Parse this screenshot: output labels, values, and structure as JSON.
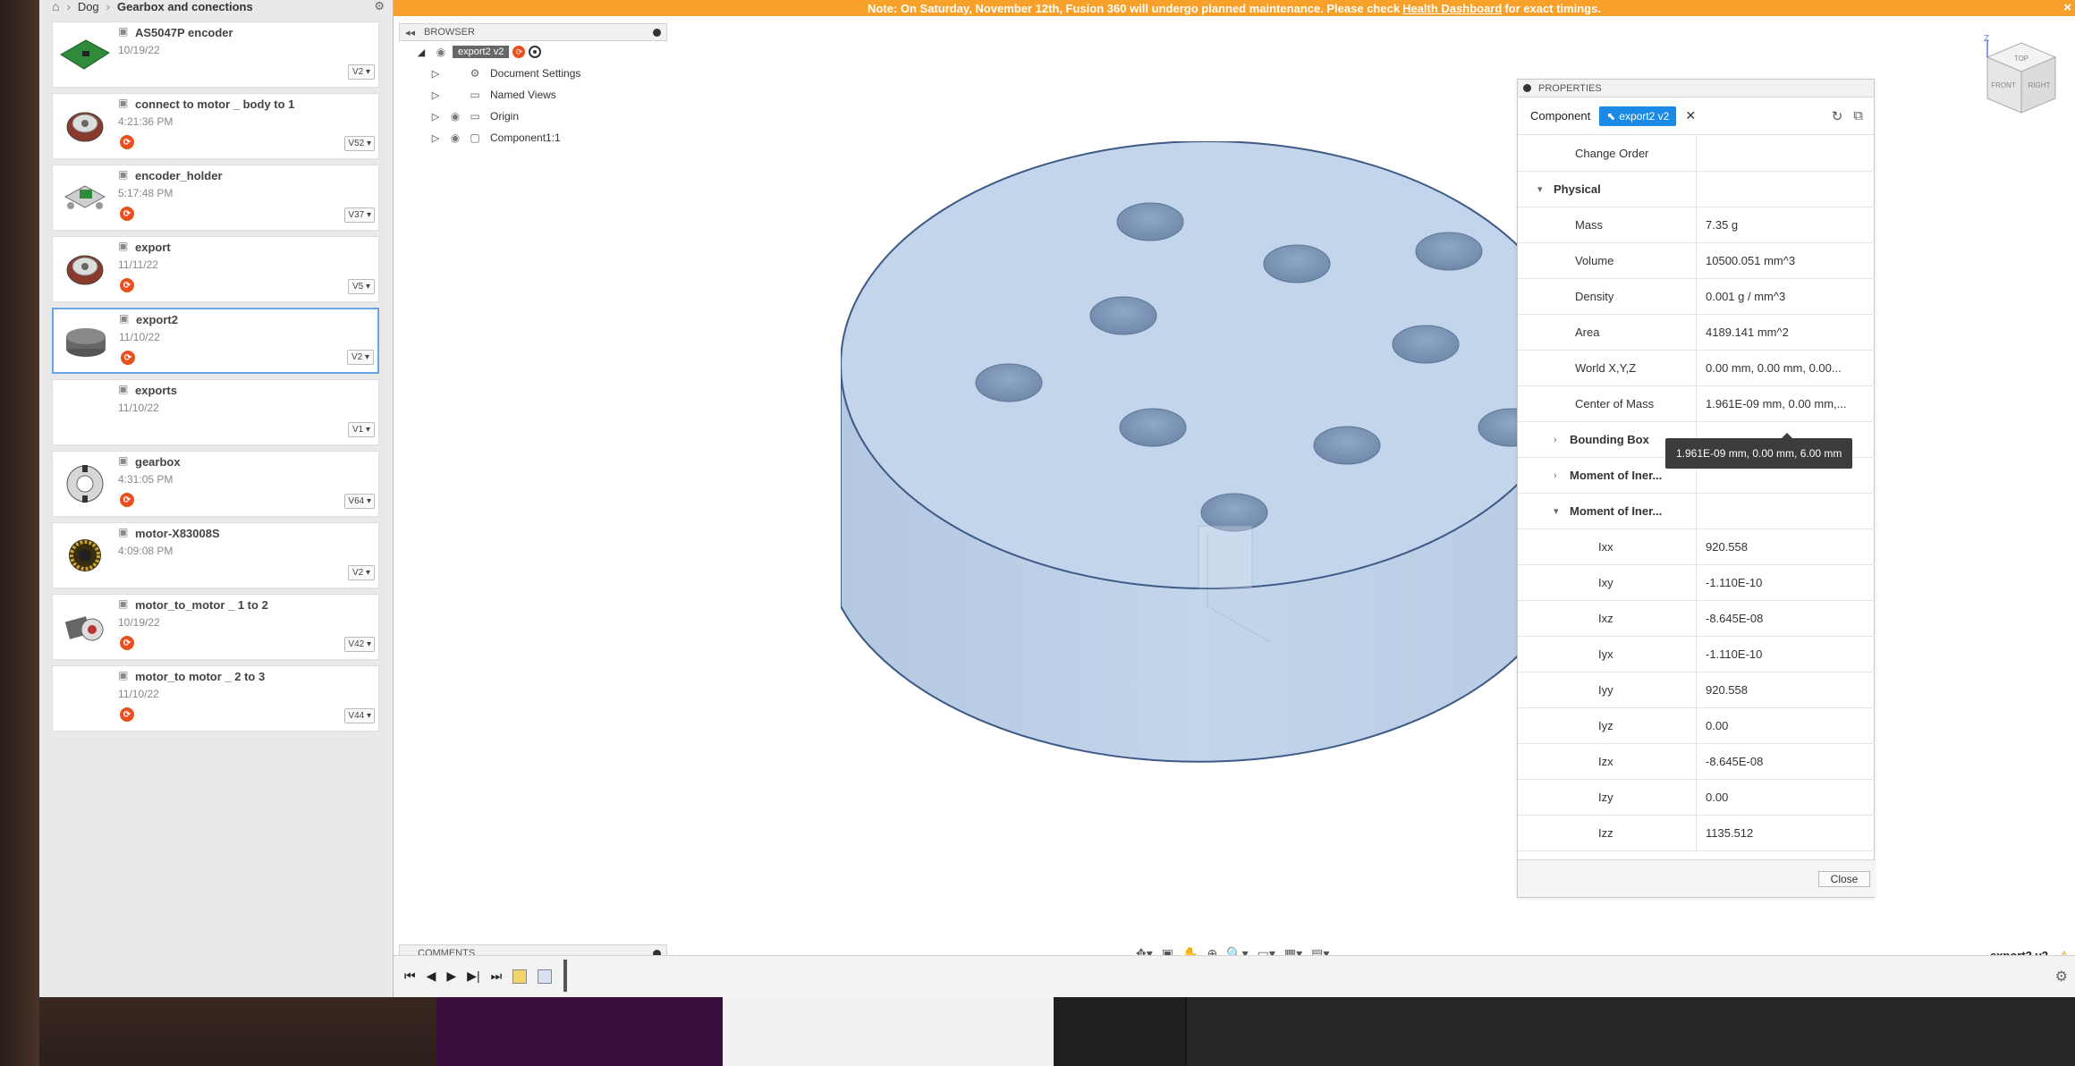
{
  "notice": {
    "prefix": "Note: On Saturday, November 12th, Fusion 360 will undergo planned maintenance. Please check",
    "link": "Health Dashboard",
    "suffix": "for exact timings.",
    "close": "×"
  },
  "data_panel": {
    "breadcrumb": {
      "project": "Dog",
      "folder": "Gearbox and conections"
    },
    "files": [
      {
        "name": "AS5047P encoder",
        "date": "10/19/22",
        "version": "V2 ▾",
        "badge": false,
        "thumb": "pcb"
      },
      {
        "name": "connect to motor _ body to 1",
        "date": "4:21:36 PM",
        "version": "V52 ▾",
        "badge": true,
        "thumb": "motor"
      },
      {
        "name": "encoder_holder",
        "date": "5:17:48 PM",
        "version": "V37 ▾",
        "badge": true,
        "thumb": "holder"
      },
      {
        "name": "export",
        "date": "11/11/22",
        "version": "V5 ▾",
        "badge": true,
        "thumb": "motor"
      },
      {
        "name": "export2",
        "date": "11/10/22",
        "version": "V2 ▾",
        "badge": true,
        "thumb": "disk",
        "selected": true
      },
      {
        "name": "exports",
        "date": "11/10/22",
        "version": "V1 ▾",
        "badge": false,
        "thumb": "none"
      },
      {
        "name": "gearbox",
        "date": "4:31:05 PM",
        "version": "V64 ▾",
        "badge": true,
        "thumb": "gearbox"
      },
      {
        "name": "motor-X83008S",
        "date": "4:09:08 PM",
        "version": "V2 ▾",
        "badge": false,
        "thumb": "coil"
      },
      {
        "name": "motor_to_motor _ 1 to 2",
        "date": "10/19/22",
        "version": "V42 ▾",
        "badge": true,
        "thumb": "assembly"
      },
      {
        "name": "motor_to motor _ 2 to 3",
        "date": "11/10/22",
        "version": "V44 ▾",
        "badge": true,
        "thumb": "none"
      }
    ]
  },
  "browser": {
    "title": "BROWSER",
    "root": "export2 v2",
    "items": [
      {
        "label": "Document Settings",
        "icon": "gear-icon"
      },
      {
        "label": "Named Views",
        "icon": "folder-icon"
      },
      {
        "label": "Origin",
        "icon": "folder-icon"
      },
      {
        "label": "Component1:1",
        "icon": "component-icon"
      }
    ]
  },
  "comments": {
    "title": "COMMENTS"
  },
  "properties": {
    "title": "PROPERTIES",
    "selection_type": "Component",
    "selection_name": "export2 v2",
    "rows": [
      {
        "kind": "plain-top",
        "label": "Change Order",
        "value": ""
      },
      {
        "kind": "group",
        "arrow": "▾",
        "label": "Physical",
        "value": ""
      },
      {
        "kind": "plain",
        "label": "Mass",
        "value": "7.35 g"
      },
      {
        "kind": "plain",
        "label": "Volume",
        "value": "10500.051 mm^3"
      },
      {
        "kind": "plain",
        "label": "Density",
        "value": "0.001 g / mm^3"
      },
      {
        "kind": "plain",
        "label": "Area",
        "value": "4189.141 mm^2"
      },
      {
        "kind": "plain",
        "label": "World X,Y,Z",
        "value": "0.00 mm, 0.00 mm, 0.00..."
      },
      {
        "kind": "plain",
        "label": "Center of Mass",
        "value": "1.961E-09 mm, 0.00 mm,..."
      },
      {
        "kind": "subgroup",
        "arrow": "›",
        "label": "Bounding Box",
        "value": ""
      },
      {
        "kind": "subgroup",
        "arrow": "›",
        "label": "Moment of Iner...",
        "value": ""
      },
      {
        "kind": "subgroup",
        "arrow": "▾",
        "label": "Moment of Iner...",
        "value": ""
      },
      {
        "kind": "deep",
        "label": "Ixx",
        "value": "920.558"
      },
      {
        "kind": "deep",
        "label": "Ixy",
        "value": "-1.110E-10"
      },
      {
        "kind": "deep",
        "label": "Ixz",
        "value": "-8.645E-08"
      },
      {
        "kind": "deep",
        "label": "Iyx",
        "value": "-1.110E-10"
      },
      {
        "kind": "deep",
        "label": "Iyy",
        "value": "920.558"
      },
      {
        "kind": "deep",
        "label": "Iyz",
        "value": "0.00"
      },
      {
        "kind": "deep",
        "label": "Izx",
        "value": "-8.645E-08"
      },
      {
        "kind": "deep",
        "label": "Izy",
        "value": "0.00"
      },
      {
        "kind": "deep",
        "label": "Izz",
        "value": "1135.512"
      }
    ],
    "tooltip": "1.961E-09 mm, 0.00 mm, 6.00 mm",
    "close_label": "Close"
  },
  "viewcube": {
    "top": "TOP",
    "front": "FRONT",
    "right": "RIGHT",
    "axis": "Z"
  },
  "document_tab": "export2 v2",
  "colors": {
    "notice": "#f7a12a",
    "selection": "#1a8ae6",
    "badge": "#e8501e",
    "model_fill": "#bfd3ea"
  }
}
